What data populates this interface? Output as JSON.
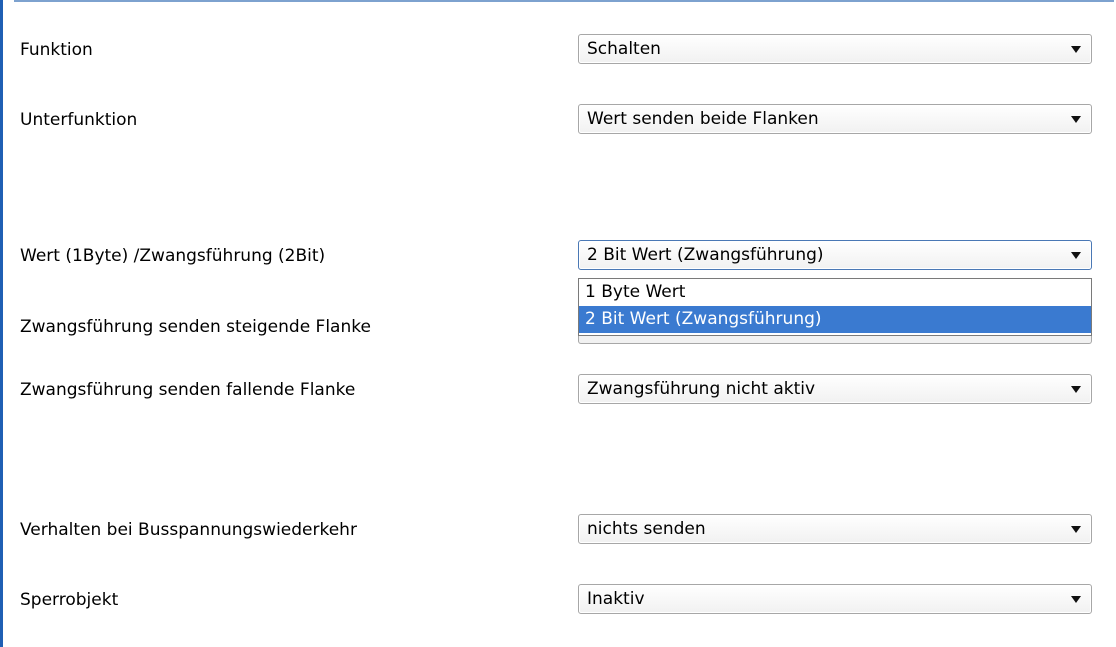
{
  "header_caption": "",
  "params": [
    {
      "label": "Funktion",
      "value": "Schalten"
    },
    {
      "label": "Unterfunktion",
      "value": "Wert senden beide Flanken"
    },
    {
      "label": "Wert (1Byte) /Zwangsführung (2Bit)",
      "value": "2 Bit Wert (Zwangsführung)"
    },
    {
      "label": "Zwangsführung senden steigende Flanke",
      "value": ""
    },
    {
      "label": "Zwangsführung senden fallende Flanke",
      "value": "Zwangsführung nicht aktiv"
    },
    {
      "label": "Verhalten bei Busspannungswiederkehr",
      "value": "nichts senden"
    },
    {
      "label": "Sperrobjekt",
      "value": "Inaktiv"
    }
  ],
  "dropdown": {
    "options": [
      "1 Byte Wert",
      "2 Bit Wert (Zwangsführung)"
    ],
    "selected_index": 1
  },
  "colors": {
    "accent": "#1f5fb4",
    "selection": "#3a7ad0"
  }
}
